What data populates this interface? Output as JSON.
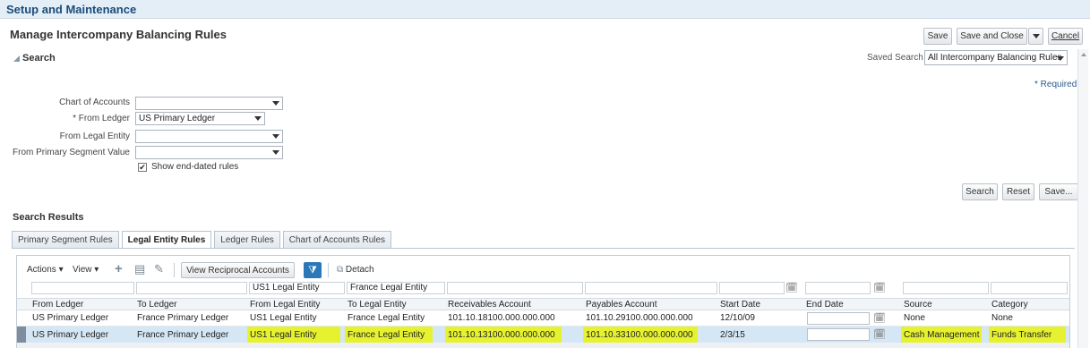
{
  "app": {
    "title": "Setup and Maintenance"
  },
  "page": {
    "title": "Manage Intercompany Balancing Rules"
  },
  "actions": {
    "save": "Save",
    "save_close": "Save and Close",
    "cancel": "Cancel"
  },
  "search": {
    "header": "Search",
    "saved_search_label": "Saved Search",
    "saved_search_value": "All Intercompany Balancing Rules",
    "required_note": "* Required",
    "fields": {
      "chart_of_accounts": {
        "label": "Chart of Accounts",
        "value": ""
      },
      "from_ledger": {
        "label": "* From Ledger",
        "value": "US Primary Ledger"
      },
      "from_legal_entity": {
        "label": "From Legal Entity",
        "value": ""
      },
      "from_primary_segment": {
        "label": "From Primary Segment Value",
        "value": ""
      }
    },
    "show_end_dated": {
      "label": "Show end-dated rules",
      "checked": true
    },
    "buttons": {
      "search": "Search",
      "reset": "Reset",
      "save": "Save..."
    }
  },
  "results": {
    "header": "Search Results",
    "tabs": [
      "Primary Segment Rules",
      "Legal Entity Rules",
      "Ledger Rules",
      "Chart of Accounts Rules"
    ],
    "active_tab": "Legal Entity Rules",
    "toolbar": {
      "actions": "Actions",
      "view": "View",
      "view_reciprocal": "View Reciprocal Accounts",
      "detach": "Detach"
    },
    "filters": {
      "from_legal_entity": "US1 Legal Entity",
      "to_legal_entity": "France Legal Entity"
    },
    "columns": [
      "From Ledger",
      "To Ledger",
      "From Legal Entity",
      "To Legal Entity",
      "Receivables Account",
      "Payables Account",
      "Start Date",
      "End Date",
      "Source",
      "Category"
    ],
    "rows": [
      {
        "from_ledger": "US Primary Ledger",
        "to_ledger": "France Primary Ledger",
        "from_le": "US1 Legal Entity",
        "to_le": "France Legal Entity",
        "receivables": "101.10.18100.000.000.000",
        "payables": "101.10.29100.000.000.000",
        "start": "12/10/09",
        "end": "",
        "source": "None",
        "category": "None"
      },
      {
        "from_ledger": "US Primary Ledger",
        "to_ledger": "France Primary Ledger",
        "from_le": "US1 Legal Entity",
        "to_le": "France Legal Entity",
        "receivables": "101.10.13100.000.000.000",
        "payables": "101.10.33100.000.000.000",
        "start": "2/3/15",
        "end": "",
        "source": "Cash Management",
        "category": "Funds Transfer"
      }
    ]
  },
  "colors": {
    "highlight": "#e6f230",
    "selected_row": "#d5e6f5",
    "header_text": "#1a4c7a"
  }
}
